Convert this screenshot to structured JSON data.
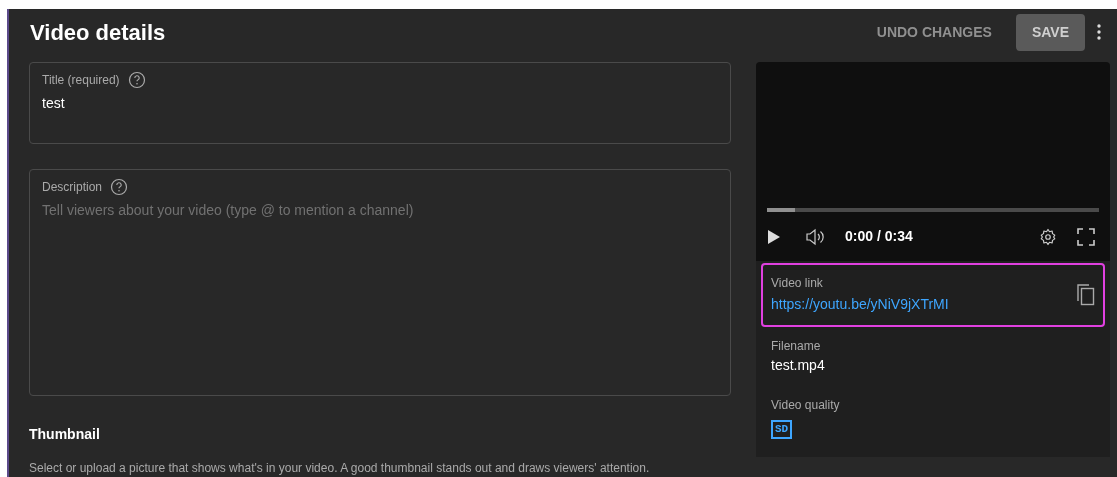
{
  "header": {
    "title": "Video details",
    "actions": [
      {
        "label": "UNDO CHANGES",
        "kind": "text"
      },
      {
        "label": "SAVE",
        "kind": "filled"
      }
    ]
  },
  "fields": [
    {
      "label": "Title (required)",
      "value": "test",
      "kind": "title"
    },
    {
      "label": "Description",
      "placeholder": "Tell viewers about your video (type @ to mention a channel)",
      "kind": "description"
    }
  ],
  "thumbnail": {
    "heading": "Thumbnail",
    "text": "Select or upload a picture that shows what's in your video. A good thumbnail stands out and draws viewers' attention."
  },
  "player": {
    "progress": {
      "level": 0.085
    },
    "time": "0:00 / 0:34"
  },
  "info": {
    "link": {
      "label": "Video link",
      "url": "https://youtu.be/yNiV9jXTrMI"
    },
    "filename": {
      "label": "Filename",
      "value": "test.mp4"
    },
    "quality": {
      "label": "Video quality",
      "badge": "SD"
    }
  }
}
